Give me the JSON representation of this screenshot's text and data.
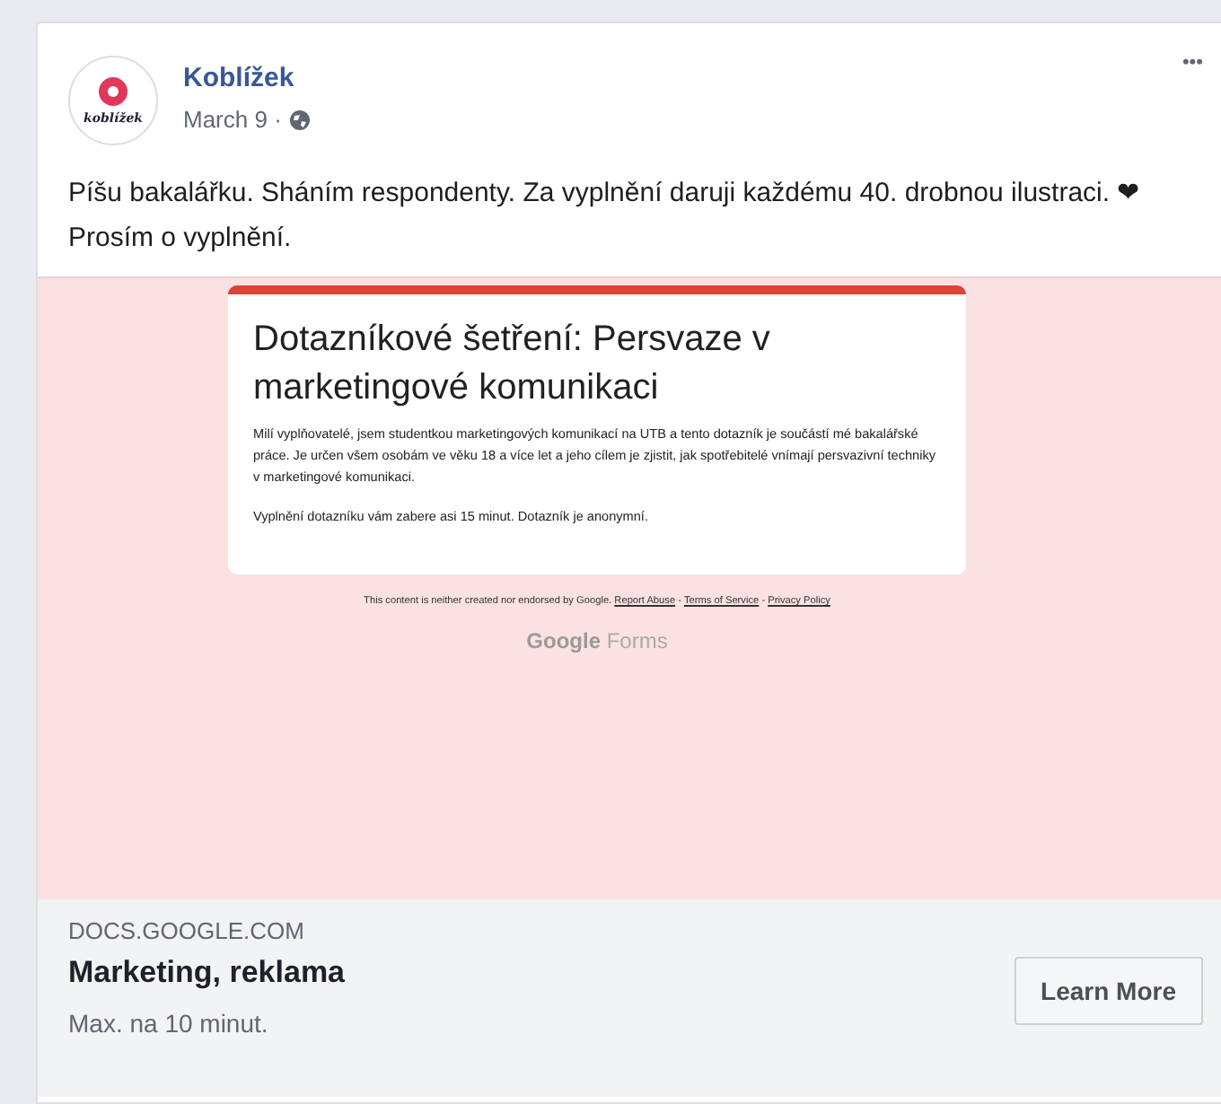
{
  "post": {
    "page_name": "Koblížek",
    "avatar_text": "koblížek",
    "date": "March 9 ·",
    "message": "Píšu bakalářku. Sháním respondenty. Za vyplnění daruji každému 40. drobnou ilustraci.",
    "heart": "❤",
    "message_end": "Prosím o vyplnění.",
    "menu": "•••"
  },
  "preview": {
    "form_title": "Dotazníkové šetření: Persvaze v marketingové komunikaci",
    "form_paragraphs": [
      "Milí vyplňovatelé, jsem studentkou marketingových komunikací na UTB a tento dotazník je součástí mé bakalářské práce. Je určen všem osobám ve věku 18 a více let a jeho cílem je zjistit, jak spotřebitelé vnímají persvazivní techniky v marketingové komunikaci.",
      "Vyplnění dotazníku vám zabere asi 15 minut. Dotazník je anonymní."
    ],
    "disclaimer": "This content is neither created nor endorsed by Google.",
    "links": [
      "Report Abuse",
      "Terms of Service",
      "Privacy Policy"
    ],
    "link_separator": "-",
    "brand_google": "Google",
    "brand_forms": "Forms"
  },
  "link": {
    "domain": "DOCS.GOOGLE.COM",
    "title": "Marketing, reklama",
    "description": "Max. na 10 minut.",
    "button": "Learn More"
  }
}
